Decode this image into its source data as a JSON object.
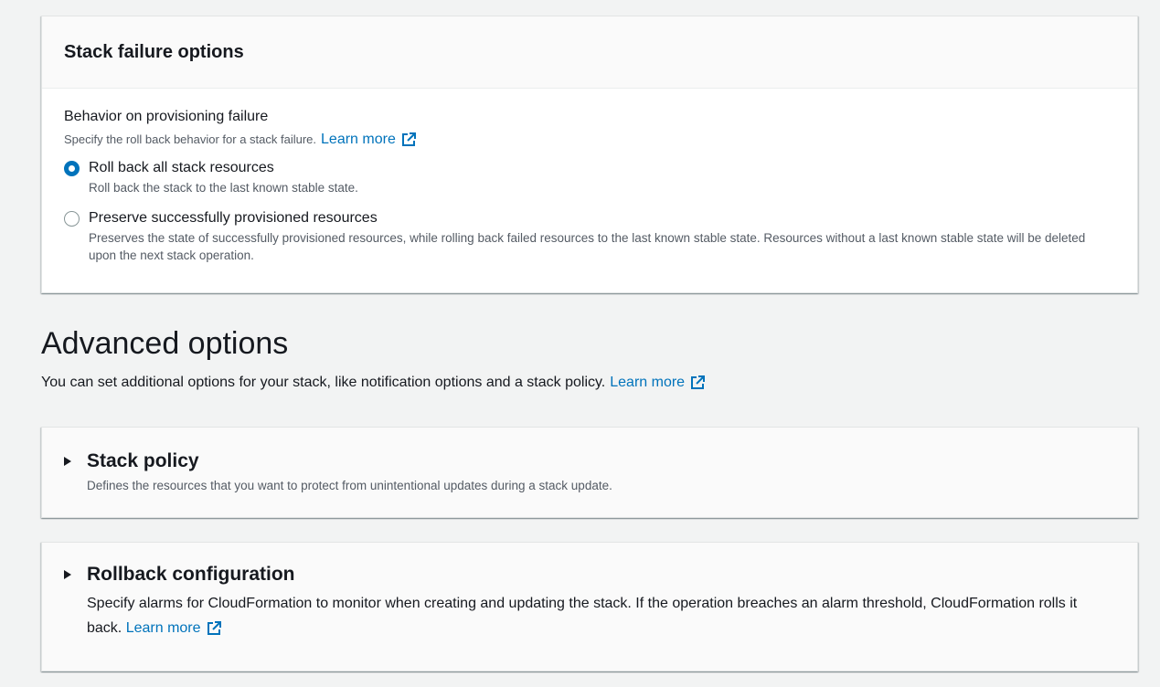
{
  "stack_failure": {
    "title": "Stack failure options",
    "field_label": "Behavior on provisioning failure",
    "field_description": "Specify the roll back behavior for a stack failure.",
    "learn_more": "Learn more",
    "options": [
      {
        "label": "Roll back all stack resources",
        "description": "Roll back the stack to the last known stable state.",
        "selected": true
      },
      {
        "label": "Preserve successfully provisioned resources",
        "description": "Preserves the state of successfully provisioned resources, while rolling back failed resources to the last known stable state. Resources without a last known stable state will be deleted upon the next stack operation.",
        "selected": false
      }
    ]
  },
  "advanced": {
    "heading": "Advanced options",
    "description": "You can set additional options for your stack, like notification options and a stack policy.",
    "learn_more": "Learn more"
  },
  "stack_policy": {
    "title": "Stack policy",
    "description": "Defines the resources that you want to protect from unintentional updates during a stack update."
  },
  "rollback_config": {
    "title": "Rollback configuration",
    "description": "Specify alarms for CloudFormation to monitor when creating and updating the stack. If the operation breaches an alarm threshold, CloudFormation rolls it back.",
    "learn_more": "Learn more"
  },
  "icons": {
    "external_link": "external-link-icon",
    "caret": "caret-right-icon"
  },
  "colors": {
    "link": "#0073bb",
    "radio_selected": "#0073bb",
    "background": "#f2f3f3"
  }
}
